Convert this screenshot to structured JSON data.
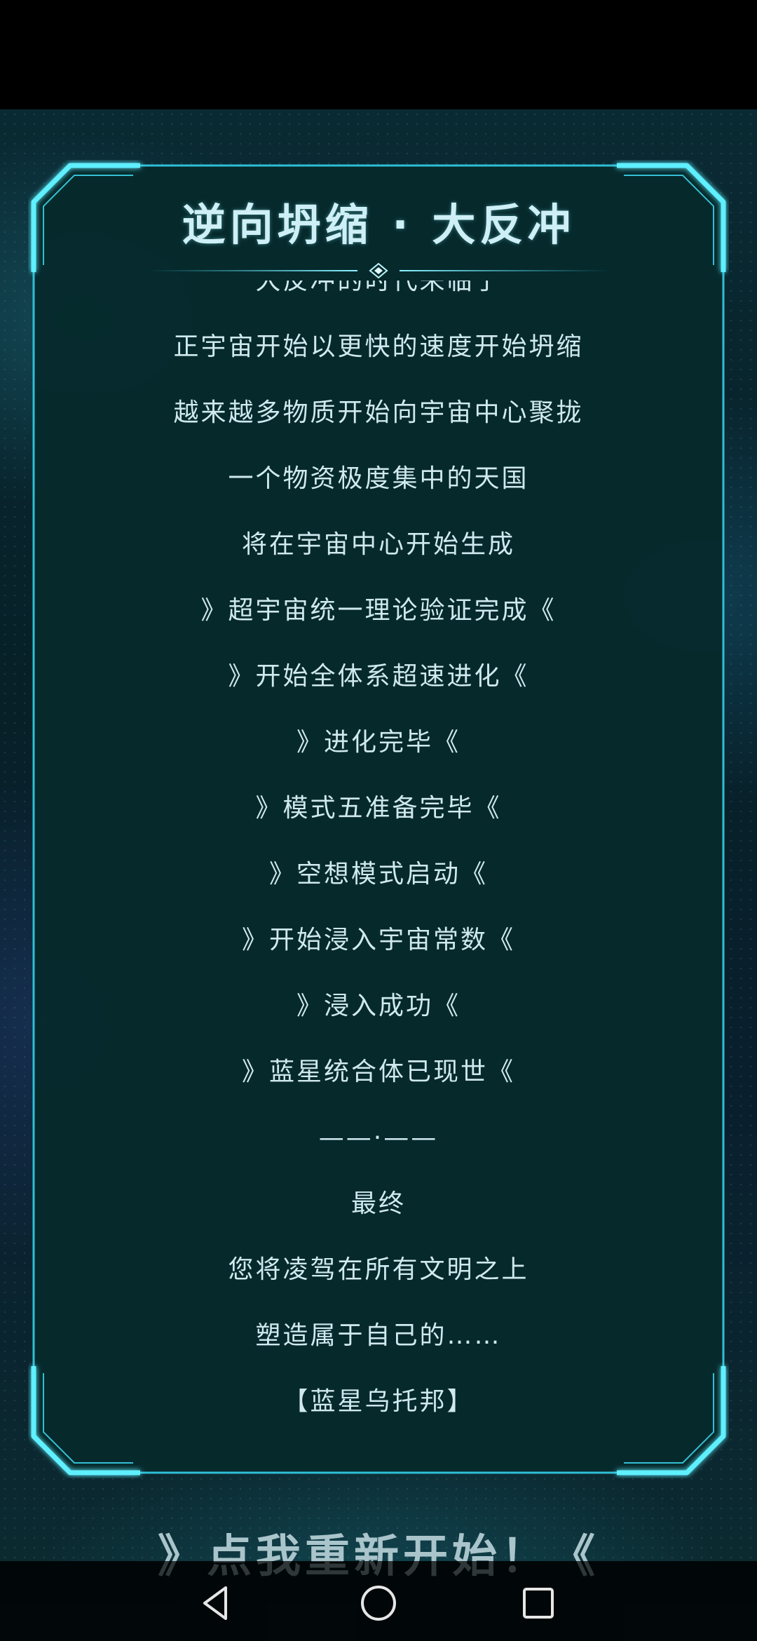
{
  "panel": {
    "title": "逆向坍缩 · 大反冲"
  },
  "story": {
    "lines": [
      "大反冲的时代来临了",
      "正宇宙开始以更快的速度开始坍缩",
      "越来越多物质开始向宇宙中心聚拢",
      "一个物资极度集中的天国",
      "将在宇宙中心开始生成",
      "》超宇宙统一理论验证完成《",
      "》开始全体系超速进化《",
      "》进化完毕《",
      "》模式五准备完毕《",
      "》空想模式启动《",
      "》开始浸入宇宙常数《",
      "》浸入成功《",
      "》蓝星统合体已现世《",
      "——·——",
      "最终",
      "您将凌驾在所有文明之上",
      "塑造属于自己的……",
      "【蓝星乌托邦】"
    ]
  },
  "actions": {
    "restart_label": "》点我重新开始！《"
  },
  "icons": {
    "back": "back-triangle-icon",
    "home": "home-circle-icon",
    "recents": "recents-square-icon"
  },
  "colors": {
    "panel_fill": "#062a2c",
    "frame_glow": "#3fe6ff",
    "text": "#cfe9ef",
    "background": "#061a20"
  }
}
